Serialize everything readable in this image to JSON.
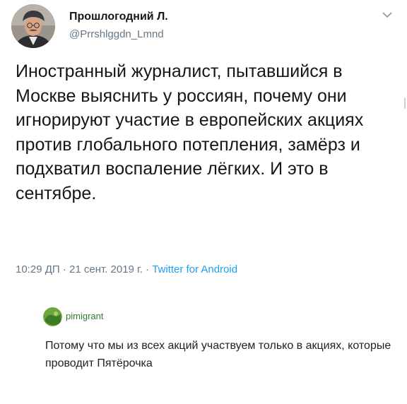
{
  "tweet": {
    "author_name": "Прошлогодний Л.",
    "author_handle": "@Prrshlggdn_Lmnd",
    "text": "Иностранный журналист, пытавшийся в Москве выяснить у россиян, почему они игнорируют участие в европейских акциях против глобального потепления, замёрз и подхватил воспаление лёгких. И это в сентябре.",
    "time": "10:29 ДП",
    "separator": "·",
    "date": "21 сент. 2019 г.",
    "app": "Twitter for Android",
    "menu_icon": "chevron-down-icon",
    "colors": {
      "text": "#14171a",
      "secondary": "#657786",
      "link": "#1da1f2"
    }
  },
  "comment": {
    "username": "pimigrant",
    "text": "Потому что мы из всех акций участвуем только в акциях, которые проводит Пятёрочка",
    "colors": {
      "username": "#2e7d32",
      "text": "#222222"
    }
  }
}
